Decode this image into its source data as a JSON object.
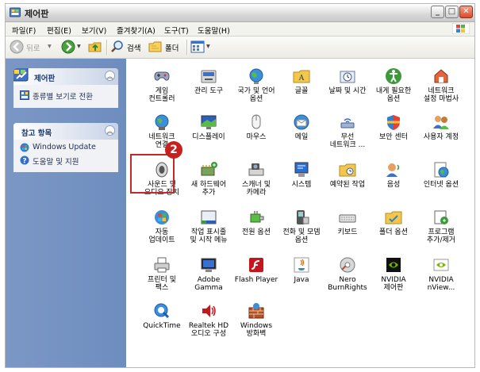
{
  "window": {
    "title": "제어판"
  },
  "titlebar_buttons": {
    "minimize": "_",
    "maximize": "□",
    "close": "✕"
  },
  "menu": [
    "파일(F)",
    "편집(E)",
    "보기(V)",
    "즐겨찾기(A)",
    "도구(T)",
    "도움말(H)"
  ],
  "toolbar": {
    "back": "뒤로",
    "search": "검색",
    "folders": "폴더"
  },
  "sidebar": {
    "panel1": {
      "title": "제어판",
      "collapse": "︽",
      "links": [
        {
          "icon": "switch-view-icon",
          "label": "종류별 보기로 전환"
        }
      ]
    },
    "panel2": {
      "title": "참고 항목",
      "collapse": "︽",
      "links": [
        {
          "icon": "windows-update-icon",
          "label": "Windows Update"
        },
        {
          "icon": "help-icon",
          "label": "도움말 및 지원"
        }
      ]
    }
  },
  "items": [
    {
      "label": "게임\n컨트롤러",
      "icon": "game-controller-icon"
    },
    {
      "label": "관리 도구",
      "icon": "admin-tools-icon"
    },
    {
      "label": "국가 및 언어\n옵션",
      "icon": "globe-icon"
    },
    {
      "label": "글꼴",
      "icon": "fonts-folder-icon"
    },
    {
      "label": "날짜 및 시간",
      "icon": "clock-icon"
    },
    {
      "label": "내게 필요한\n옵션",
      "icon": "accessibility-icon"
    },
    {
      "label": "네트워크\n설정 마법사",
      "icon": "network-setup-icon"
    },
    {
      "label": "네트워크\n연결",
      "icon": "network-connections-icon"
    },
    {
      "label": "디스플레이",
      "icon": "display-icon"
    },
    {
      "label": "마우스",
      "icon": "mouse-icon"
    },
    {
      "label": "메일",
      "icon": "mail-icon"
    },
    {
      "label": "무선\n네트워크 ...",
      "icon": "wireless-icon"
    },
    {
      "label": "보안 센터",
      "icon": "security-shield-icon"
    },
    {
      "label": "사용자 계정",
      "icon": "user-accounts-icon"
    },
    {
      "label": "사운드 및\n오디오 장치",
      "icon": "speaker-icon"
    },
    {
      "label": "새 하드웨어\n추가",
      "icon": "add-hardware-icon"
    },
    {
      "label": "스캐너 및\n카메라",
      "icon": "scanner-camera-icon"
    },
    {
      "label": "시스템",
      "icon": "system-icon"
    },
    {
      "label": "예약된 작업",
      "icon": "scheduled-tasks-icon"
    },
    {
      "label": "음성",
      "icon": "speech-icon"
    },
    {
      "label": "인터넷 옵션",
      "icon": "internet-options-icon"
    },
    {
      "label": "자동\n업데이트",
      "icon": "automatic-updates-icon"
    },
    {
      "label": "작업 표시줄\n및 시작 메뉴",
      "icon": "taskbar-icon"
    },
    {
      "label": "전원 옵션",
      "icon": "power-icon"
    },
    {
      "label": "전화 및 모뎀\n옵션",
      "icon": "phone-modem-icon"
    },
    {
      "label": "키보드",
      "icon": "keyboard-icon"
    },
    {
      "label": "폴더 옵션",
      "icon": "folder-options-icon"
    },
    {
      "label": "프로그램\n추가/제거",
      "icon": "add-remove-programs-icon"
    },
    {
      "label": "프린터 및\n팩스",
      "icon": "printer-icon"
    },
    {
      "label": "Adobe\nGamma",
      "icon": "adobe-gamma-icon"
    },
    {
      "label": "Flash Player",
      "icon": "flash-icon"
    },
    {
      "label": "Java",
      "icon": "java-icon"
    },
    {
      "label": "Nero\nBurnRights",
      "icon": "nero-icon"
    },
    {
      "label": "NVIDIA\n제어판",
      "icon": "nvidia-icon"
    },
    {
      "label": "NVIDIA\nnView...",
      "icon": "nvidia-nview-icon"
    },
    {
      "label": "QuickTime",
      "icon": "quicktime-icon"
    },
    {
      "label": "Realtek HD\n오디오 구성",
      "icon": "realtek-audio-icon"
    },
    {
      "label": "Windows\n방화벽",
      "icon": "firewall-icon"
    }
  ],
  "annotation": {
    "step": "2"
  },
  "colors": {
    "sidebar": "#7b97c5",
    "highlight": "#c32a2a",
    "badge": "#c8201e"
  }
}
